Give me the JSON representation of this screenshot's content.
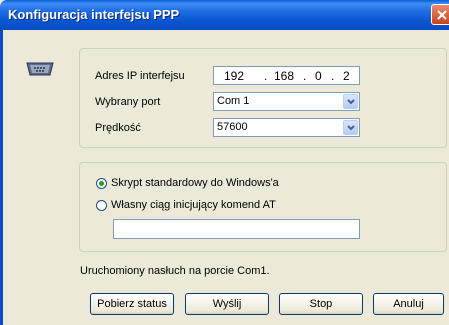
{
  "window": {
    "title": "Konfiguracja interfejsu PPP"
  },
  "form": {
    "ip_label": "Adres IP interfejsu",
    "ip": [
      "192",
      "168",
      "0",
      "2"
    ],
    "port_label": "Wybrany port",
    "port_value": "Com 1",
    "speed_label": "Prędkość",
    "speed_value": "57600"
  },
  "script_options": {
    "standard_label": "Skrypt standardowy do Windows'a",
    "standard_selected": true,
    "custom_label": "Własny ciąg inicjujący komend AT",
    "custom_selected": false,
    "custom_value": ""
  },
  "status_text": "Uruchomiony nasłuch na porcie Com1.",
  "buttons": {
    "status": "Pobierz status",
    "send": "Wyślij",
    "stop": "Stop",
    "cancel": "Anuluj"
  },
  "icons": {
    "device": "serial-port-icon",
    "close": "close-icon",
    "dropdown": "chevron-down-icon"
  }
}
